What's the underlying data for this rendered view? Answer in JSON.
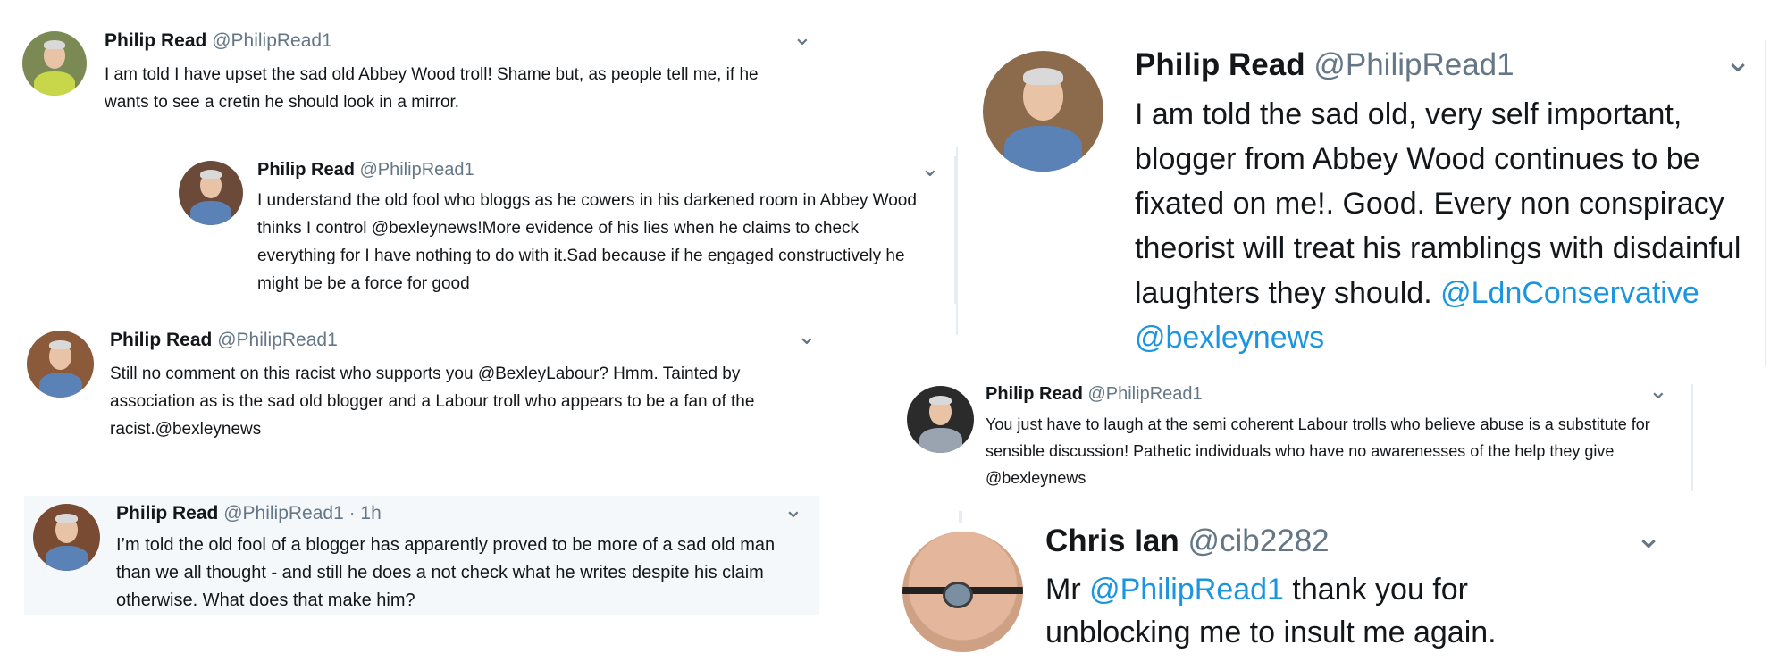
{
  "t1": {
    "name": "Philip Read",
    "handle": "@PhilipRead1",
    "text": "I am told I have upset the sad old Abbey Wood troll! Shame but, as people tell me, if he wants to see a cretin he should look in a mirror."
  },
  "t2": {
    "name": "Philip Read",
    "handle": "@PhilipRead1",
    "text_a": "I understand the old fool who bloggs as he cowers in his darkened room in Abbey Wood thinks I control ",
    "mention": "@bexleynews",
    "text_b": "!More evidence of his lies when he claims to check everything for I have nothing to do with it.Sad because if he engaged constructively he might be be a force for good"
  },
  "t3": {
    "name": "Philip Read",
    "handle": "@PhilipRead1",
    "text": "Still no comment on this racist who supports you @BexleyLabour? Hmm. Tainted by association as is the sad old blogger and a Labour troll who appears to be a fan of the racist.@bexleynews"
  },
  "t4": {
    "name": "Philip Read",
    "handle": "@PhilipRead1 · 1h",
    "text": "I’m told the old fool of a blogger has apparently proved to be more of a sad old man than we all thought - and still he does a not check what he writes despite his claim otherwise. What does that make him?"
  },
  "t5": {
    "name": "Philip Read",
    "handle": "@PhilipRead1",
    "text_a": "I am told the sad old, very self important, blogger from Abbey Wood continues to be fixated on me!. Good. Every non conspiracy theorist will treat his ramblings with disdainful laughters they should. ",
    "mention1": "@LdnConservative",
    "mention2": "@bexleynews"
  },
  "t6": {
    "name": "Philip Read",
    "handle": "@PhilipRead1",
    "text": "You just have to laugh at the semi coherent Labour trolls who believe abuse is a substitute for sensible discussion! Pathetic individuals who have no awarenesses of the help they give @bexleynews"
  },
  "t7": {
    "name": "Chris Ian",
    "handle": "@cib2282",
    "text_a": "Mr ",
    "mention": "@PhilipRead1",
    "text_b": " thank you for unblocking me to insult me again."
  },
  "caret_glyph": "⌄"
}
